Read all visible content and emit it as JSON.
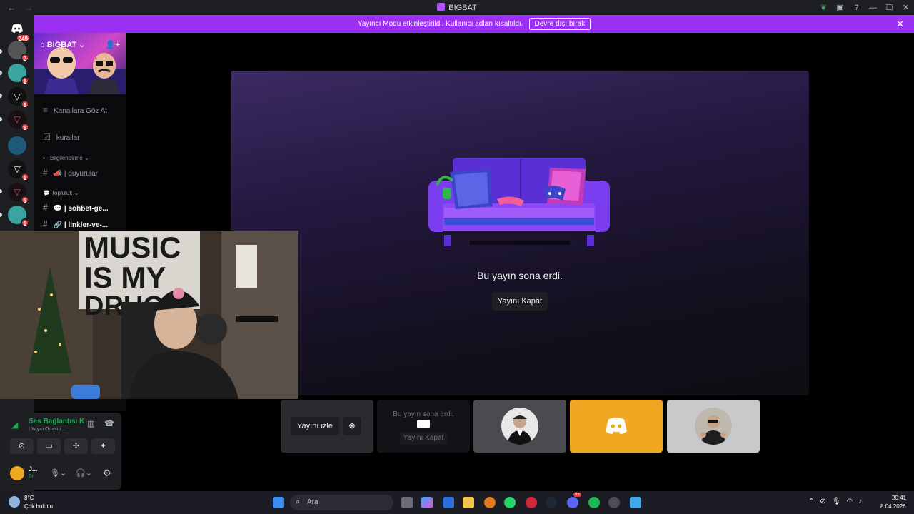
{
  "window": {
    "title": "BIGBAT",
    "back": "←",
    "forward": "→"
  },
  "banner": {
    "text": "Yayıncı Modu etkinleştirildi. Kullanıcı adları kısaltıldı.",
    "button": "Devre dışı bırak"
  },
  "rail": {
    "home_badge": "249",
    "badges": [
      "2",
      "1",
      "1",
      "1",
      "1",
      "6",
      "1"
    ]
  },
  "server": {
    "name": "BIGBAT"
  },
  "channels": {
    "browse": "Kanallara Göz At",
    "rules": "kurallar",
    "cat_info": "Bilgilendirme",
    "announce": "| duyurular",
    "cat_community": "Topluluk",
    "chat": "| sohbet-ge...",
    "links": "| linkler-ve-..."
  },
  "stream": {
    "ended_text": "Bu yayın sona erdi.",
    "close_button": "Yayını Kapat"
  },
  "tiles": {
    "watch": "Yayını izle",
    "ended_text": "Bu yayın sona erdi.",
    "close": "Yayını Kapat"
  },
  "voice": {
    "status": "Ses Bağlantısı K",
    "room": "| Yayın Odası / ...",
    "user": "J...",
    "user_sub": "Sı"
  },
  "taskbar": {
    "temp": "8°C",
    "weather": "Çok bulutlu",
    "search": "Ara",
    "time": "20:41",
    "date": "8.04.2026",
    "discord_badge": "9+"
  },
  "colors": {
    "accent": "#9b30f3",
    "rail": "#1e1f22",
    "stage_top": "#3b2a63",
    "tile_orange": "#f0a722"
  }
}
